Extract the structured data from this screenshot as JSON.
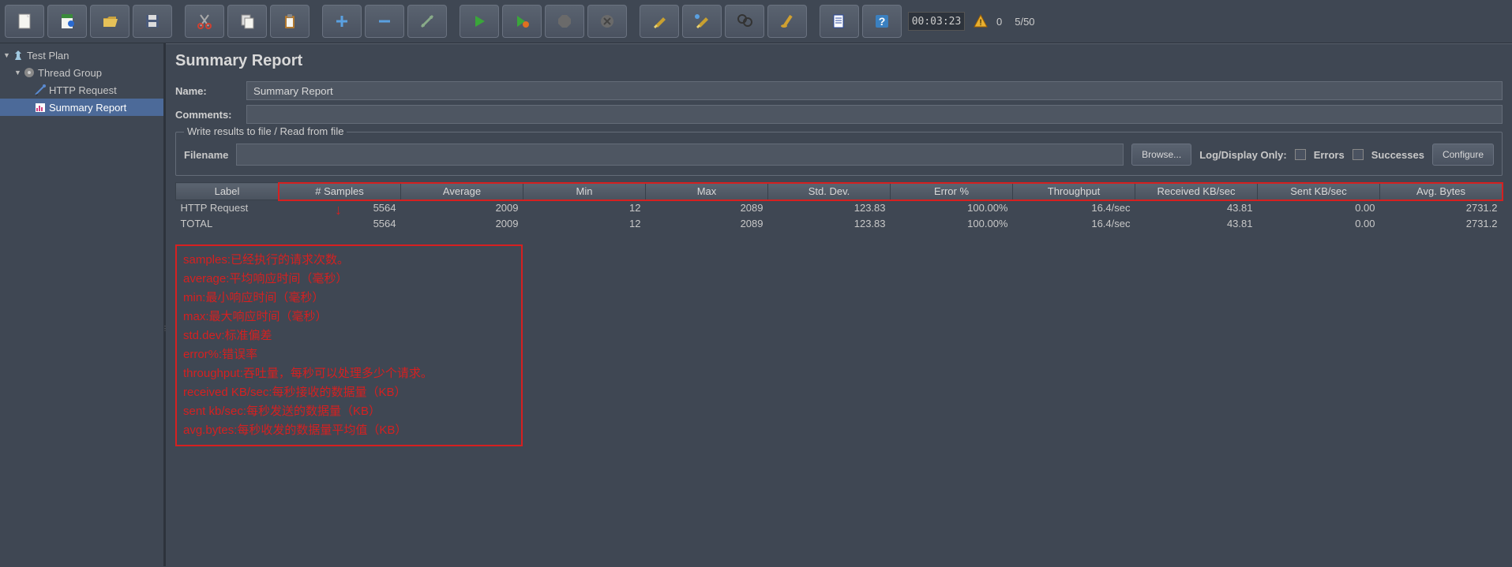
{
  "toolbar": {
    "timer": "00:03:23",
    "warn_count": "0",
    "threads": "5/50"
  },
  "tree": {
    "root": "Test Plan",
    "group": "Thread Group",
    "sampler": "HTTP Request",
    "listener": "Summary Report"
  },
  "panel": {
    "title": "Summary Report",
    "name_label": "Name:",
    "name_value": "Summary Report",
    "comments_label": "Comments:",
    "fieldset_legend": "Write results to file / Read from file",
    "filename_label": "Filename",
    "browse": "Browse...",
    "logdisplay": "Log/Display Only:",
    "errors": "Errors",
    "successes": "Successes",
    "configure": "Configure"
  },
  "table": {
    "headers": [
      "Label",
      "# Samples",
      "Average",
      "Min",
      "Max",
      "Std. Dev.",
      "Error %",
      "Throughput",
      "Received KB/sec",
      "Sent KB/sec",
      "Avg. Bytes"
    ],
    "rows": [
      {
        "label": "HTTP Request",
        "samples": "5564",
        "avg": "2009",
        "min": "12",
        "max": "2089",
        "std": "123.83",
        "err": "100.00%",
        "thr": "16.4/sec",
        "recv": "43.81",
        "sent": "0.00",
        "bytes": "2731.2"
      },
      {
        "label": "TOTAL",
        "samples": "5564",
        "avg": "2009",
        "min": "12",
        "max": "2089",
        "std": "123.83",
        "err": "100.00%",
        "thr": "16.4/sec",
        "recv": "43.81",
        "sent": "0.00",
        "bytes": "2731.2"
      }
    ]
  },
  "annotation": {
    "l1": "samples:已经执行的请求次数。",
    "l2": "average:平均响应时间（毫秒）",
    "l3": "min:最小响应时间（毫秒）",
    "l4": "max:最大响应时间（毫秒）",
    "l5": "std.dev:标准偏差",
    "l6": "error%:错误率",
    "l7": "throughput:吞吐量，每秒可以处理多少个请求。",
    "l8": "received KB/sec:每秒接收的数据量（KB）",
    "l9": "sent kb/sec:每秒发送的数据量（KB）",
    "l10": "avg.bytes:每秒收发的数据量平均值（KB）"
  }
}
